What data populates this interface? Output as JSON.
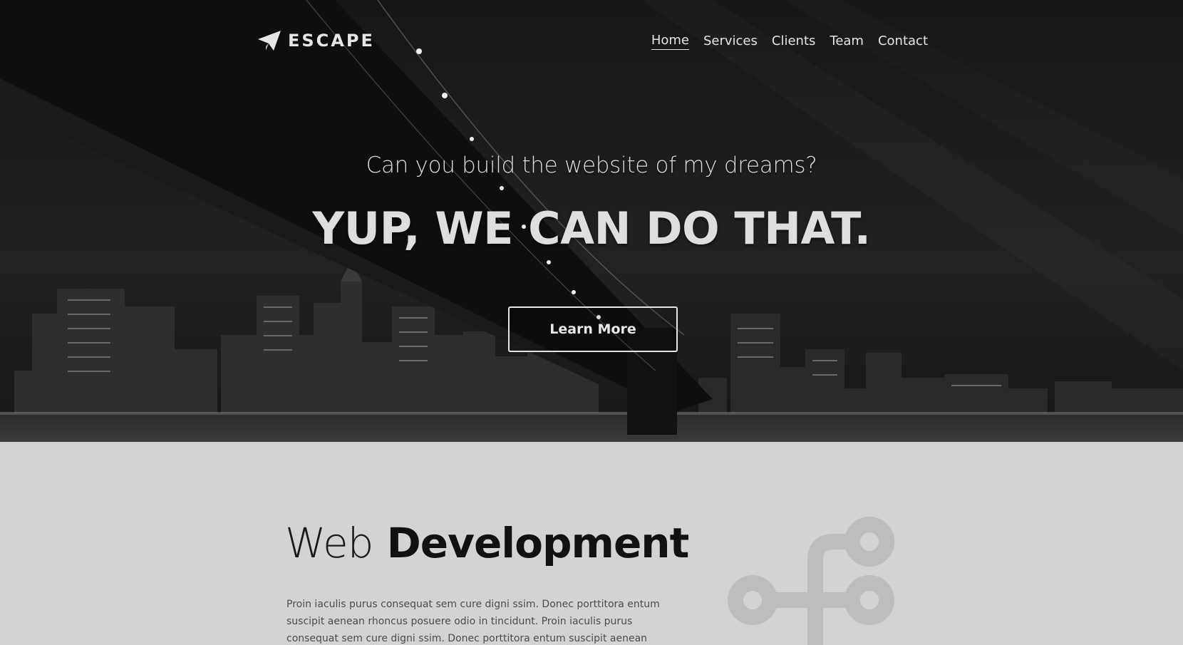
{
  "brand": {
    "logo_icon": "paper-plane-icon",
    "name": "ESCAPE"
  },
  "nav": {
    "items": [
      {
        "label": "Home",
        "active": true
      },
      {
        "label": "Services",
        "active": false
      },
      {
        "label": "Clients",
        "active": false
      },
      {
        "label": "Team",
        "active": false
      },
      {
        "label": "Contact",
        "active": false
      }
    ]
  },
  "hero": {
    "subtitle": "Can you build the website of my dreams?",
    "title": "YUP, WE CAN DO THAT.",
    "button_label": "Learn More"
  },
  "section": {
    "heading_light": "Web",
    "heading_bold": "Development",
    "body": "Proin iaculis purus consequat sem cure digni ssim. Donec porttitora entum suscipit aenean rhoncus posuere odio in tincidunt. Proin iaculis purus consequat sem cure digni ssim. Donec porttitora entum suscipit aenean rhoncus posuere odio in tincidunt.",
    "icon": "code-fork-icon"
  },
  "colors": {
    "hero_bg": "#1b1b1b",
    "section_bg": "#d3d3d3",
    "text_light": "#e4e4e4",
    "text_dark": "#111111"
  }
}
